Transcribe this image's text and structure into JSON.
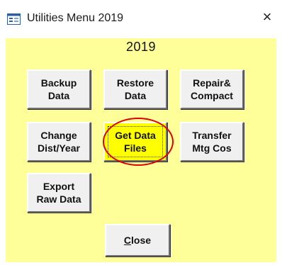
{
  "window": {
    "title": "Utilities Menu 2019",
    "close_glyph": "×",
    "app_icon": "form-icon"
  },
  "form": {
    "year": "2019",
    "background": "#ffff99",
    "buttons": [
      {
        "label": "Backup\nData"
      },
      {
        "label": "Restore\nData"
      },
      {
        "label": "Repair&\nCompact"
      },
      {
        "label": "Change\nDist/Year"
      },
      {
        "label": "Get Data\nFiles",
        "focused": true,
        "highlight": "#ffff00"
      },
      {
        "label": "Transfer\nMtg Cos"
      },
      {
        "label": "Export\nRaw Data"
      }
    ],
    "close_button": {
      "label_prefix": "C",
      "label_rest": "lose"
    }
  },
  "annotation": {
    "color": "#e00000",
    "icon": "red-ellipse-highlight"
  }
}
